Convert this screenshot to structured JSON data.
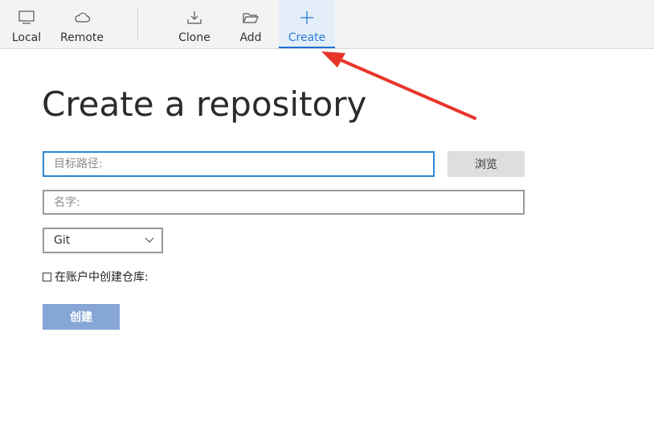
{
  "toolbar": {
    "items": [
      {
        "label": "Local",
        "icon": "monitor-icon"
      },
      {
        "label": "Remote",
        "icon": "cloud-icon"
      },
      {
        "label": "Clone",
        "icon": "download-icon"
      },
      {
        "label": "Add",
        "icon": "folder-open-icon"
      },
      {
        "label": "Create",
        "icon": "plus-icon",
        "active": true
      }
    ]
  },
  "page": {
    "title": "Create a repository"
  },
  "form": {
    "path_placeholder": "目标路径:",
    "path_value": "",
    "browse_label": "浏览",
    "name_placeholder": "名字:",
    "name_value": "",
    "vcs_selected": "Git",
    "create_in_account_label": "在账户中创建仓库:",
    "create_in_account_checked": false,
    "create_label": "创建"
  },
  "colors": {
    "accent": "#2c7cd6",
    "active_tab_bg": "#e3eef9",
    "create_button": "#86a6d6",
    "annotation_arrow": "#e8352a"
  }
}
